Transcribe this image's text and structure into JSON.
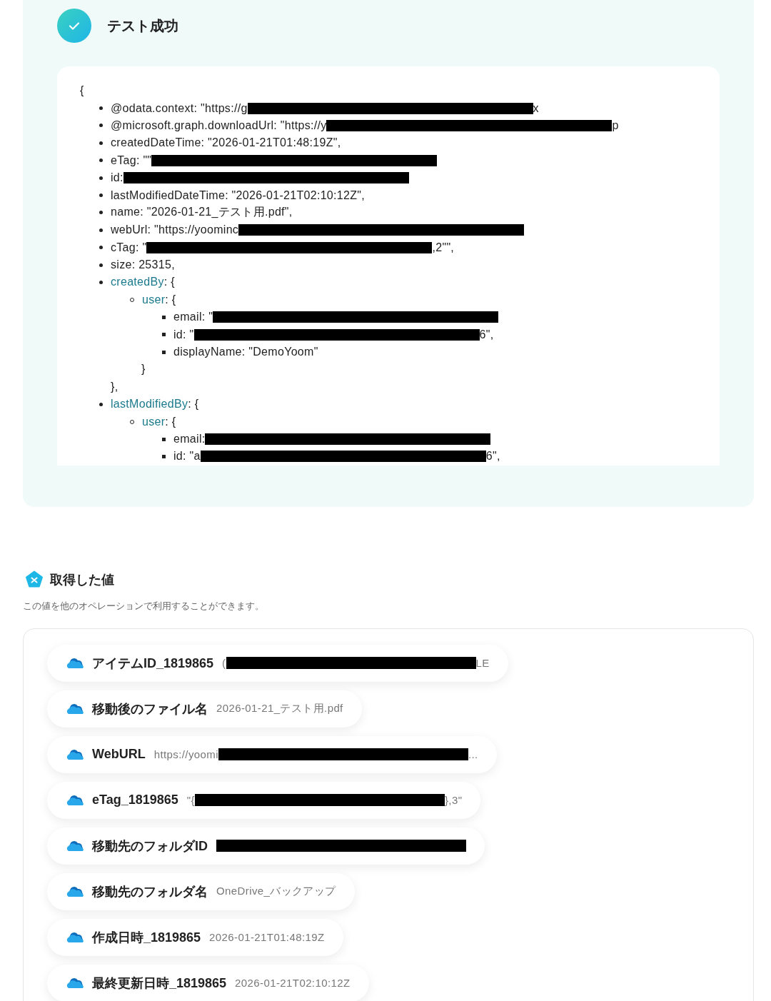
{
  "status": {
    "title": "テスト成功",
    "success": true
  },
  "output": {
    "open": "{",
    "items": [
      {
        "kind": "field",
        "before": "@odata.context: \"https://g",
        "redacted": true,
        "after": "x"
      },
      {
        "kind": "field",
        "before": "@microsoft.graph.downloadUrl: \"https://y",
        "redacted": true,
        "after": "p"
      },
      {
        "kind": "field",
        "before": "createdDateTime: \"2026-01-21T01:48:19Z\","
      },
      {
        "kind": "field",
        "before": "eTag: \"\"",
        "redacted": true
      },
      {
        "kind": "field",
        "before": "id: ",
        "redacted": true
      },
      {
        "kind": "field",
        "before": "lastModifiedDateTime: \"2026-01-21T02:10:12Z\","
      },
      {
        "kind": "field",
        "before": "name: \"2026-01-21_テスト用.pdf\","
      },
      {
        "kind": "field",
        "before": "webUrl: \"https://yoominc",
        "redacted": true
      },
      {
        "kind": "field",
        "before": "cTag: \"",
        "redacted": true,
        "after": ",2\"\","
      },
      {
        "kind": "field",
        "before": "size: 25315,"
      },
      {
        "kind": "object",
        "key": "createdBy",
        "open": ": {",
        "close": "},",
        "children": [
          {
            "kind": "object",
            "key": "user",
            "open": ": {",
            "close": "}",
            "children": [
              {
                "kind": "field",
                "before": "email: \"",
                "redacted": true
              },
              {
                "kind": "field",
                "before": "id: \"",
                "redacted": true,
                "after": "6\","
              },
              {
                "kind": "field",
                "before": "displayName: \"DemoYoom\""
              }
            ]
          }
        ]
      },
      {
        "kind": "object",
        "key": "lastModifiedBy",
        "open": ": {",
        "children": [
          {
            "kind": "object",
            "key": "user",
            "open": ": {",
            "children": [
              {
                "kind": "field",
                "before": "email: ",
                "redacted": true
              },
              {
                "kind": "field",
                "before": "id: \"a",
                "redacted": true,
                "after": "6\","
              }
            ]
          }
        ]
      }
    ]
  },
  "section": {
    "title": "取得した値",
    "description": "この値を他のオペレーションで利用することができます。"
  },
  "values": [
    {
      "label": "アイテムID_1819865",
      "before": "(",
      "redacted": true,
      "after": "LE"
    },
    {
      "label": "移動後のファイル名",
      "before": "2026-01-21_テスト用.pdf"
    },
    {
      "label": "WebURL",
      "before": "https://yoomi",
      "redacted": true,
      "after": "..."
    },
    {
      "label": "eTag_1819865",
      "before": "\"{",
      "redacted": true,
      "after": "},3\""
    },
    {
      "label": "移動先のフォルダID",
      "redacted": true
    },
    {
      "label": "移動先のフォルダ名",
      "before": "OneDrive_バックアップ"
    },
    {
      "label": "作成日時_1819865",
      "before": "2026-01-21T01:48:19Z"
    },
    {
      "label": "最終更新日時_1819865",
      "before": "2026-01-21T02:10:12Z"
    }
  ]
}
